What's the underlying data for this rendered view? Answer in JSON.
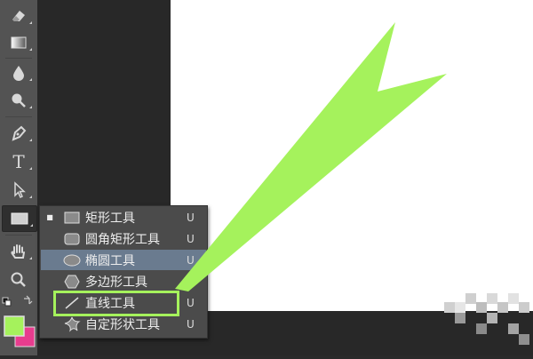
{
  "toolbar": {
    "tools": [
      {
        "name": "eraser-tool"
      },
      {
        "name": "gradient-tool"
      },
      {
        "name": "blur-tool"
      },
      {
        "name": "dodge-tool"
      },
      {
        "name": "pen-tool"
      },
      {
        "name": "type-tool",
        "glyph": "T"
      },
      {
        "name": "path-selection-tool"
      },
      {
        "name": "shape-tool",
        "active": true
      },
      {
        "name": "hand-tool"
      },
      {
        "name": "zoom-tool"
      }
    ],
    "foreground_color": "#a5f25c",
    "background_color": "#e83c8e"
  },
  "flyout": {
    "items": [
      {
        "label": "矩形工具",
        "shortcut": "U",
        "icon": "rectangle-icon",
        "selected": true
      },
      {
        "label": "圆角矩形工具",
        "shortcut": "U",
        "icon": "rounded-rectangle-icon"
      },
      {
        "label": "椭圆工具",
        "shortcut": "U",
        "icon": "ellipse-icon",
        "highlighted": true
      },
      {
        "label": "多边形工具",
        "shortcut": "U",
        "icon": "polygon-icon"
      },
      {
        "label": "直线工具",
        "shortcut": "U",
        "icon": "line-icon"
      },
      {
        "label": "自定形状工具",
        "shortcut": "U",
        "icon": "custom-shape-icon"
      }
    ]
  },
  "annotation": {
    "color": "#a5f25c",
    "target": "直线工具"
  }
}
